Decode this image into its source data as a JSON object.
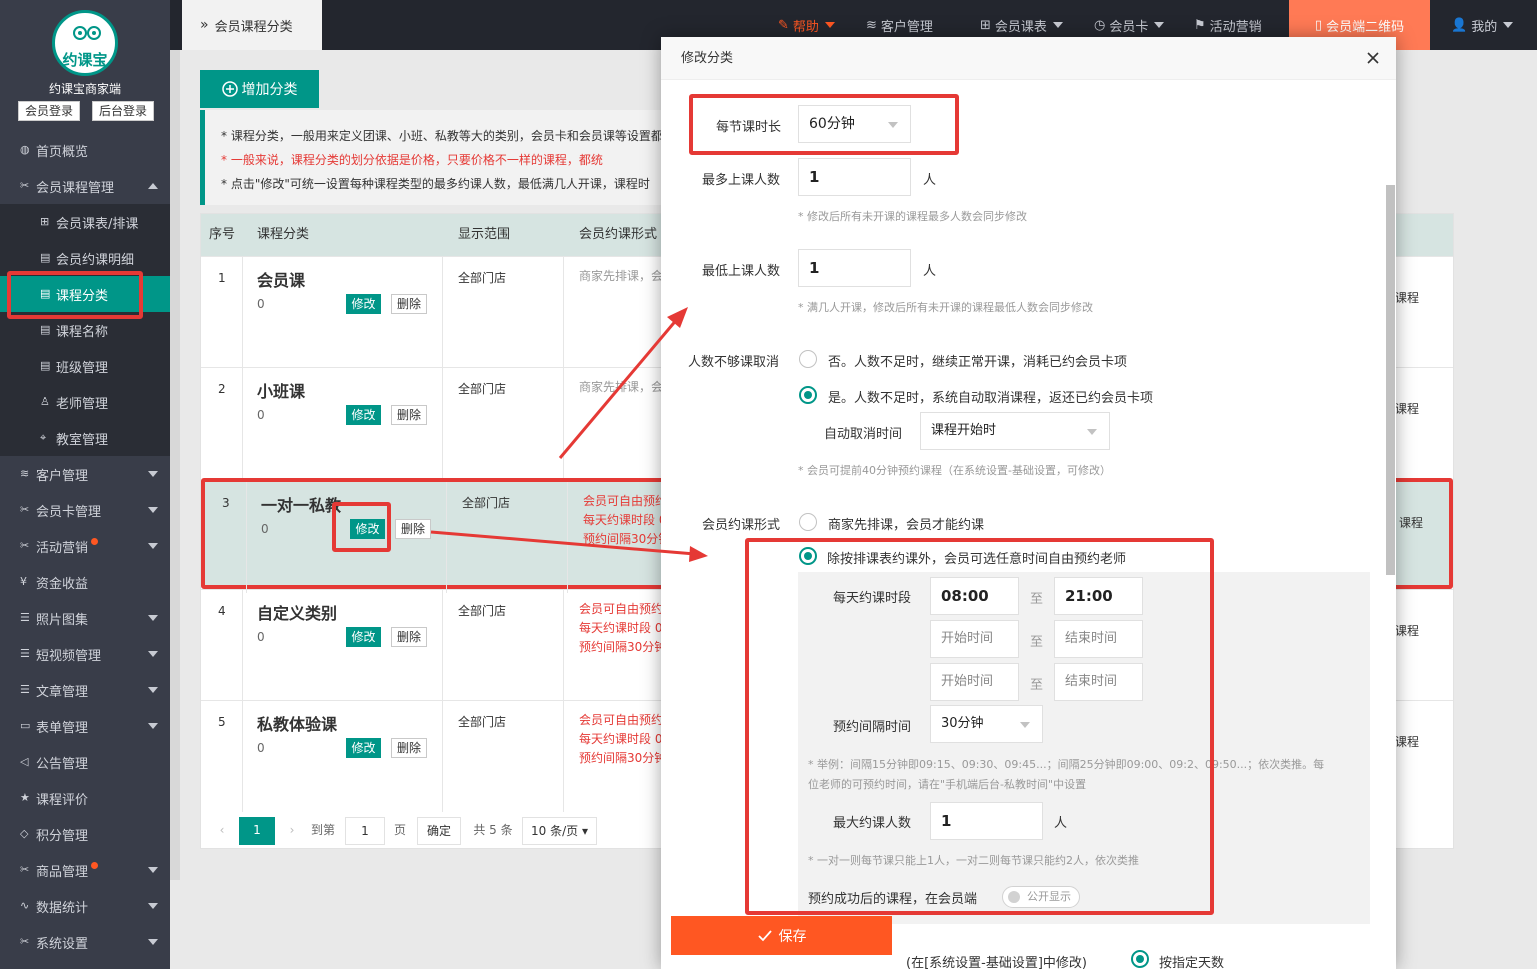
{
  "sidebar": {
    "logo_text": "约课宝",
    "brand": "约课宝商家端",
    "member_login": "会员登录",
    "admin_login": "后台登录",
    "items": [
      {
        "label": "首页概览",
        "icon": "globe-icon"
      },
      {
        "label": "会员课程管理",
        "icon": "wrench-icon",
        "expanded": true
      },
      {
        "label": "会员课表/排课",
        "icon": "book-icon"
      },
      {
        "label": "会员约课明细",
        "icon": "document-icon"
      },
      {
        "label": "课程分类",
        "icon": "document-icon",
        "active": true
      },
      {
        "label": "课程名称",
        "icon": "document-icon"
      },
      {
        "label": "班级管理",
        "icon": "document-icon"
      },
      {
        "label": "老师管理",
        "icon": "user-icon"
      },
      {
        "label": "教室管理",
        "icon": "location-icon"
      },
      {
        "label": "客户管理",
        "icon": "stack-icon"
      },
      {
        "label": "会员卡管理",
        "icon": "wrench-icon"
      },
      {
        "label": "活动营销",
        "icon": "wrench-icon",
        "dot": true
      },
      {
        "label": "资金收益",
        "icon": "yen-icon"
      },
      {
        "label": "照片图集",
        "icon": "list-icon"
      },
      {
        "label": "短视频管理",
        "icon": "list-icon"
      },
      {
        "label": "文章管理",
        "icon": "list-icon"
      },
      {
        "label": "表单管理",
        "icon": "form-icon"
      },
      {
        "label": "公告管理",
        "icon": "speaker-icon"
      },
      {
        "label": "课程评价",
        "icon": "star-icon"
      },
      {
        "label": "积分管理",
        "icon": "diamond-icon"
      },
      {
        "label": "商品管理",
        "icon": "wrench-icon",
        "dot": true
      },
      {
        "label": "数据统计",
        "icon": "chart-icon"
      },
      {
        "label": "系统设置",
        "icon": "wrench-icon"
      }
    ]
  },
  "topbar": {
    "current_tab": "会员课程分类",
    "help": "帮助",
    "customers": "客户管理",
    "schedule": "会员课表",
    "card": "会员卡",
    "marketing": "活动营销",
    "qrcode": "会员端二维码",
    "me": "我的"
  },
  "main": {
    "add_button": "增加分类",
    "notice": [
      "* 课程分类，一般用来定义团课、小班、私教等大的类别，会员卡和会员课等设置都",
      "* 一般来说，课程分类的划分依据是价格，只要价格不一样的课程，都统",
      "* 点击\"修改\"可统一设置每种课程类型的最多约课人数，最低满几人开课，课程时"
    ],
    "table": {
      "headers": [
        "序号",
        "课程分类",
        "显示范围",
        "会员约课形式"
      ],
      "edit_label": "修改",
      "delete_label": "删除",
      "rows": [
        {
          "no": "1",
          "name": "会员课",
          "count": "0",
          "scope": "全部门店",
          "mode": [
            "商家先排课，会"
          ],
          "mode_red": false,
          "tail": "课程"
        },
        {
          "no": "2",
          "name": "小班课",
          "count": "0",
          "scope": "全部门店",
          "mode": [
            "商家先排课，会"
          ],
          "mode_red": false,
          "tail": "课程"
        },
        {
          "no": "3",
          "name": "一对一私教",
          "count": "0",
          "scope": "全部门店",
          "mode": [
            "会员可自由预约",
            "每天约课时段 0",
            "预约间隔30分钟"
          ],
          "mode_red": true,
          "tail": "课程"
        },
        {
          "no": "4",
          "name": "自定义类别",
          "count": "0",
          "scope": "全部门店",
          "mode": [
            "会员可自由预约",
            "每天约课时段 0",
            "预约间隔30分钟"
          ],
          "mode_red": true,
          "tail": "课程"
        },
        {
          "no": "5",
          "name": "私教体验课",
          "count": "0",
          "scope": "全部门店",
          "mode": [
            "会员可自由预约",
            "每天约课时段 0",
            "预约间隔30分钟"
          ],
          "mode_red": true,
          "tail": "课程"
        }
      ]
    },
    "pager": {
      "current": "1",
      "goto": "到第",
      "page_input": "1",
      "page_unit": "页",
      "confirm": "确定",
      "total": "共 5 条",
      "per_page": "10 条/页"
    }
  },
  "modal": {
    "title": "修改分类",
    "duration_label": "每节课时长",
    "duration_value": "60分钟",
    "max_label": "最多上课人数",
    "max_value": "1",
    "person_unit": "人",
    "max_hint": "* 修改后所有未开课的课程最多人数会同步修改",
    "min_label": "最低上课人数",
    "min_value": "1",
    "min_hint": "* 满几人开课，修改后所有未开课的课程最低人数会同步修改",
    "cancel_label": "人数不够课取消",
    "cancel_no": "否。人数不足时，继续正常开课，消耗已约会员卡项",
    "cancel_yes": "是。人数不足时，系统自动取消课程，返还已约会员卡项",
    "auto_cancel_label": "自动取消时间",
    "auto_cancel_value": "课程开始时",
    "cancel_hint": "* 会员可提前40分钟预约课程（在系统设置-基础设置，可修改）",
    "booking_label": "会员约课形式",
    "booking_opt1": "商家先排课，会员才能约课",
    "booking_opt2": "除按排课表约课外，会员可选任意时间自由预约老师",
    "daily_label": "每天约课时段",
    "start1": "08:00",
    "end1": "21:00",
    "to": "至",
    "start_ph": "开始时间",
    "end_ph": "结束时间",
    "interval_label": "预约间隔时间",
    "interval_value": "30分钟",
    "interval_hint1": "* 举例：间隔15分钟即09:15、09:30、09:45...；间隔25分钟即09:00、09:2",
    "interval_hint1b": "、09:50...；依次类推。每",
    "interval_hint2": "位老师的可预约时间，请在\"手机端后台-私教时间\"中设置",
    "max_book_label": "最大约课人数",
    "max_book_value": "1",
    "max_book_hint": "* 一对一则每节课只能上1人，一对二则每节课只能约2人，依次类推",
    "after_label": "预约成功后的课程，在会员端",
    "toggle_label": "公开显示",
    "save": "保存",
    "bottom_text": "(在[系统设置-基础设置]中修改)",
    "bottom_radio": "按指定天数"
  },
  "colors": {
    "sidebar": "#393d49",
    "accent": "#009688",
    "highlight": "#e53935",
    "save": "#ff5722"
  }
}
